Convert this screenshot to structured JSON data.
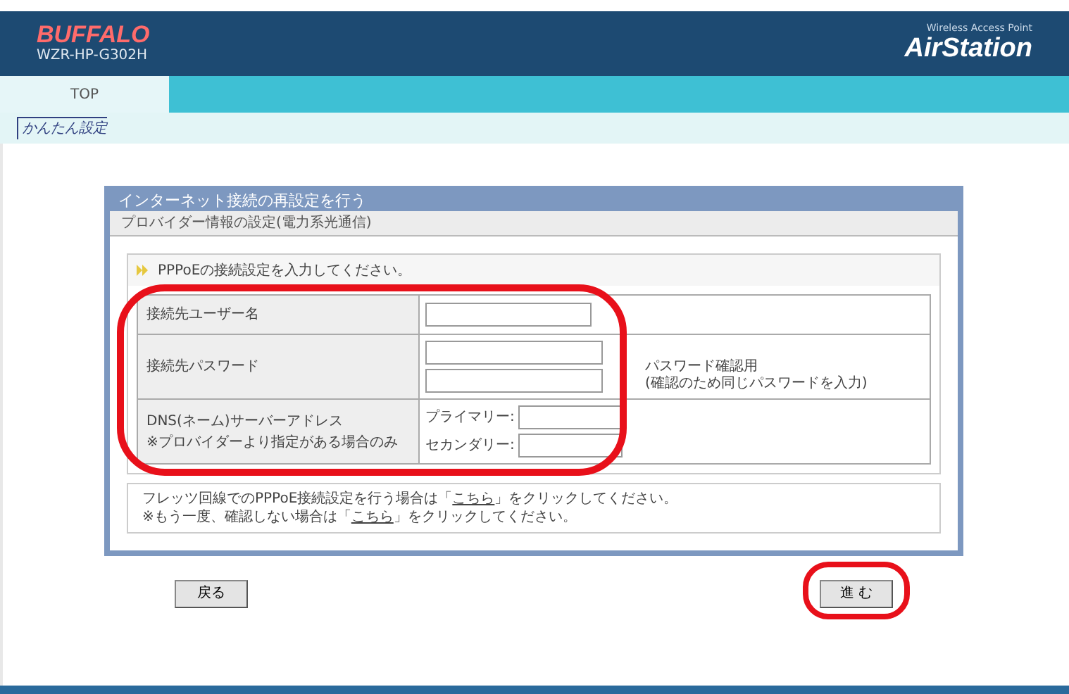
{
  "header": {
    "logo": "BUFFALO",
    "model": "WZR-HP-G302H",
    "tagline": "Wireless Access Point",
    "product": "AirStation"
  },
  "tabs": [
    {
      "label": "TOP",
      "selected": true
    }
  ],
  "breadcrumb": "かんたん設定",
  "panel": {
    "title": "インターネット接続の再設定を行う",
    "subtitle": "プロバイダー情報の設定(電力系光通信)",
    "instruction": "PPPoEの接続設定を入力してください。",
    "rows": [
      {
        "kind": "single",
        "label": "接続先ユーザー名"
      },
      {
        "kind": "password",
        "label": "接続先パスワード",
        "confirm_label": "パスワード確認用",
        "confirm_note": "(確認のため同じパスワードを入力)"
      },
      {
        "kind": "dns",
        "label": "DNS(ネーム)サーバーアドレス",
        "note": "※プロバイダーより指定がある場合のみ",
        "fields": [
          "プライマリー:",
          "セカンダリー:"
        ]
      }
    ],
    "notes": [
      {
        "before": "フレッツ回線でのPPPoE接続設定を行う場合は「",
        "link": "こちら",
        "after": "」をクリックしてください。"
      },
      {
        "before": "※もう一度、確認しない場合は「",
        "link": "こちら",
        "after": "」をクリックしてください。"
      }
    ]
  },
  "buttons": [
    {
      "label": "戻る",
      "highlighted": false
    },
    {
      "label": "進 む",
      "highlighted": true
    }
  ]
}
